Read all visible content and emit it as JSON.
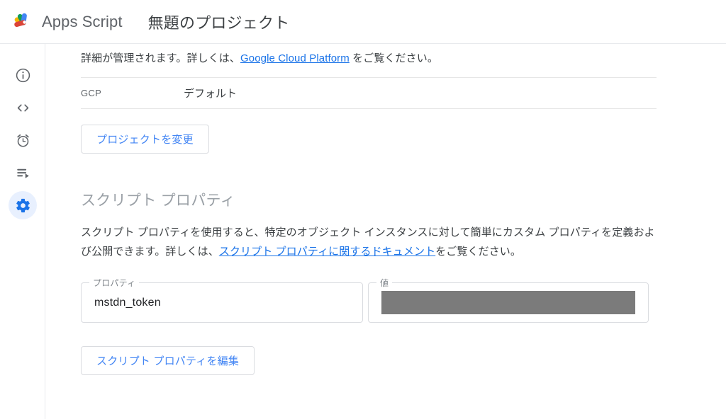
{
  "header": {
    "logo_icon": "apps-script-logo",
    "product_name": "Apps Script",
    "project_title": "無題のプロジェクト"
  },
  "sidebar": {
    "items": [
      {
        "icon": "info-circle-icon",
        "name": "overview",
        "active": false
      },
      {
        "icon": "code-brackets-icon",
        "name": "editor",
        "active": false
      },
      {
        "icon": "alarm-clock-icon",
        "name": "triggers",
        "active": false
      },
      {
        "icon": "execution-log-icon",
        "name": "executions",
        "active": false
      },
      {
        "icon": "gear-icon",
        "name": "project-settings",
        "active": true
      }
    ]
  },
  "main": {
    "gcp_section": {
      "paragraph_prefix": "詳細が管理されます。詳しくは、",
      "paragraph_link": "Google Cloud Platform",
      "paragraph_suffix": " をご覧ください。",
      "row_key": "GCP",
      "row_value": "デフォルト",
      "change_project_button": "プロジェクトを変更"
    },
    "script_properties": {
      "heading": "スクリプト プロパティ",
      "description_prefix": "スクリプト プロパティを使用すると、特定のオブジェクト インスタンスに対して簡単にカスタム プロパティを定義および公開できます。詳しくは、",
      "description_link": "スクリプト プロパティに関するドキュメント",
      "description_suffix": "をご覧ください。",
      "property_field": {
        "label": "プロパティ",
        "value": "mstdn_token"
      },
      "value_field": {
        "label": "値",
        "value": "",
        "redacted": true
      },
      "edit_button": "スクリプト プロパティを編集"
    }
  },
  "colors": {
    "accent_blue": "#4285f4",
    "link_blue": "#1a73e8",
    "active_pill": "#e8f0fe",
    "redaction_gray": "#7b7b7b",
    "divider": "#e6e6e6"
  }
}
